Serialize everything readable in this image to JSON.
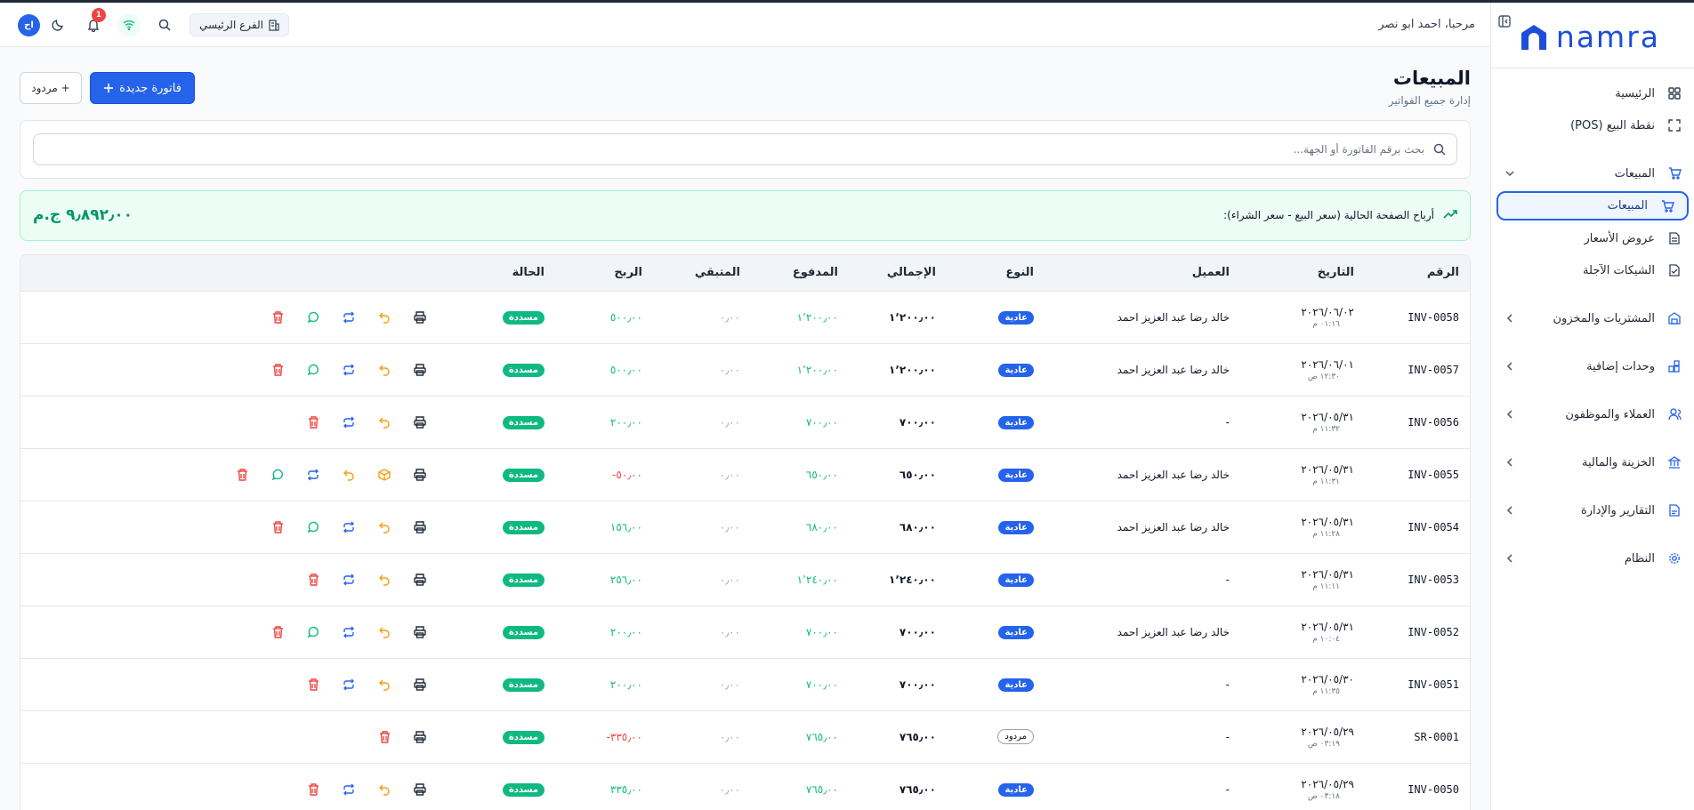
{
  "app": {
    "brand": "namra"
  },
  "header": {
    "greeting": "مرحبا، احمد ابو نصر",
    "branch": "الفرع الرئيسي",
    "notifications_count": "1",
    "avatar_initials": "اح"
  },
  "sidebar": {
    "items": [
      {
        "label": "الرئيسية",
        "icon": "dashboard-icon"
      },
      {
        "label": "نقطة البيع (POS)",
        "icon": "fullscreen-icon"
      },
      {
        "label": "المبيعات",
        "icon": "cart-icon",
        "expanded": true
      },
      {
        "label": "المبيعات",
        "icon": "cart-icon",
        "active": true
      },
      {
        "label": "عروض الأسعار",
        "icon": "document-icon"
      },
      {
        "label": "الشيكات الآجلة",
        "icon": "check-doc-icon"
      },
      {
        "label": "المشتريات والمخزون",
        "icon": "warehouse-icon"
      },
      {
        "label": "وحدات إضافية",
        "icon": "modules-icon"
      },
      {
        "label": "العملاء والموظفون",
        "icon": "users-icon"
      },
      {
        "label": "الخزينة والمالية",
        "icon": "bank-icon"
      },
      {
        "label": "التقارير والإدارة",
        "icon": "report-icon"
      },
      {
        "label": "النظام",
        "icon": "gear-icon"
      }
    ]
  },
  "page": {
    "title": "المبيعات",
    "subtitle": "إدارة جميع الفواتير",
    "new_invoice": "فاتورة جديدة",
    "return_btn": "+ مردود",
    "search_placeholder": "بحث برقم الفاتورة أو الجهة...",
    "profit_label": "أرباح الصفحة الحالية (سعر البيع - سعر الشراء):",
    "profit_value": "٩٫٨٩٢٫٠٠ ج.م"
  },
  "table": {
    "headers": [
      "الرقم",
      "التاريخ",
      "العميل",
      "النوع",
      "الإجمالي",
      "المدفوع",
      "المتبقي",
      "الربح",
      "الحالة",
      ""
    ],
    "rows": [
      {
        "no": "INV-0058",
        "date": "٢٠٢٦/٠٦/٠٢",
        "time": "٠١:١٦ م",
        "client": "خالد رضا عبد العزيز احمد",
        "type": "عادية",
        "total": "١٬٢٠٠٫٠٠",
        "paid": "١٬٢٠٠٫٠٠",
        "remaining": "٠٫٠٠",
        "profit": "٥٠٠٫٠٠",
        "status": "مسددة"
      },
      {
        "no": "INV-0057",
        "date": "٢٠٢٦/٠٦/٠١",
        "time": "١٢:٣٠ ص",
        "client": "خالد رضا عبد العزيز احمد",
        "type": "عادية",
        "total": "١٬٢٠٠٫٠٠",
        "paid": "١٬٢٠٠٫٠٠",
        "remaining": "٠٫٠٠",
        "profit": "٥٠٠٫٠٠",
        "status": "مسددة"
      },
      {
        "no": "INV-0056",
        "date": "٢٠٢٦/٠٥/٣١",
        "time": "١١:٣٢ م",
        "client": "-",
        "type": "عادية",
        "total": "٧٠٠٫٠٠",
        "paid": "٧٠٠٫٠٠",
        "remaining": "٠٫٠٠",
        "profit": "٢٠٠٫٠٠",
        "status": "مسددة"
      },
      {
        "no": "INV-0055",
        "date": "٢٠٢٦/٠٥/٣١",
        "time": "١١:٣١ م",
        "client": "خالد رضا عبد العزيز احمد",
        "type": "عادية",
        "total": "٦٥٠٫٠٠",
        "paid": "٦٥٠٫٠٠",
        "remaining": "٠٫٠٠",
        "profit": "٥٠٫٠٠-",
        "status": "مسددة"
      },
      {
        "no": "INV-0054",
        "date": "٢٠٢٦/٠٥/٣١",
        "time": "١١:٢٨ م",
        "client": "خالد رضا عبد العزيز احمد",
        "type": "عادية",
        "total": "٦٨٠٫٠٠",
        "paid": "٦٨٠٫٠٠",
        "remaining": "٠٫٠٠",
        "profit": "١٥٦٫٠٠",
        "status": "مسددة"
      },
      {
        "no": "INV-0053",
        "date": "٢٠٢٦/٠٥/٣١",
        "time": "١١:١١ م",
        "client": "-",
        "type": "عادية",
        "total": "١٬٢٤٠٫٠٠",
        "paid": "١٬٢٤٠٫٠٠",
        "remaining": "٠٫٠٠",
        "profit": "٢٥٦٫٠٠",
        "status": "مسددة"
      },
      {
        "no": "INV-0052",
        "date": "٢٠٢٦/٠٥/٣١",
        "time": "١٠:٠٤ م",
        "client": "خالد رضا عبد العزيز احمد",
        "type": "عادية",
        "total": "٧٠٠٫٠٠",
        "paid": "٧٠٠٫٠٠",
        "remaining": "٠٫٠٠",
        "profit": "٢٠٠٫٠٠",
        "status": "مسددة"
      },
      {
        "no": "INV-0051",
        "date": "٢٠٢٦/٠٥/٣٠",
        "time": "١١:٣٥ م",
        "client": "-",
        "type": "عادية",
        "total": "٧٠٠٫٠٠",
        "paid": "٧٠٠٫٠٠",
        "remaining": "٠٫٠٠",
        "profit": "٢٠٠٫٠٠",
        "status": "مسددة"
      },
      {
        "no": "SR-0001",
        "date": "٢٠٢٦/٠٥/٢٩",
        "time": "٠٣:١٩ ص",
        "client": "-",
        "type": "مردود",
        "total": "٧٦٥٫٠٠",
        "paid": "٧٦٥٫٠٠",
        "remaining": "٠٫٠٠",
        "profit": "٣٣٥٫٠٠-",
        "status": "مسددة"
      },
      {
        "no": "INV-0050",
        "date": "٢٠٢٦/٠٥/٢٩",
        "time": "٠٣:١٨ ص",
        "client": "-",
        "type": "عادية",
        "total": "٧٦٥٫٠٠",
        "paid": "٧٦٥٫٠٠",
        "remaining": "٠٫٠٠",
        "profit": "٣٣٥٫٠٠",
        "status": "مسددة"
      }
    ]
  },
  "colors": {
    "primary": "#2563eb",
    "success": "#10b981",
    "danger": "#ef4444",
    "warning": "#f59e0b"
  }
}
